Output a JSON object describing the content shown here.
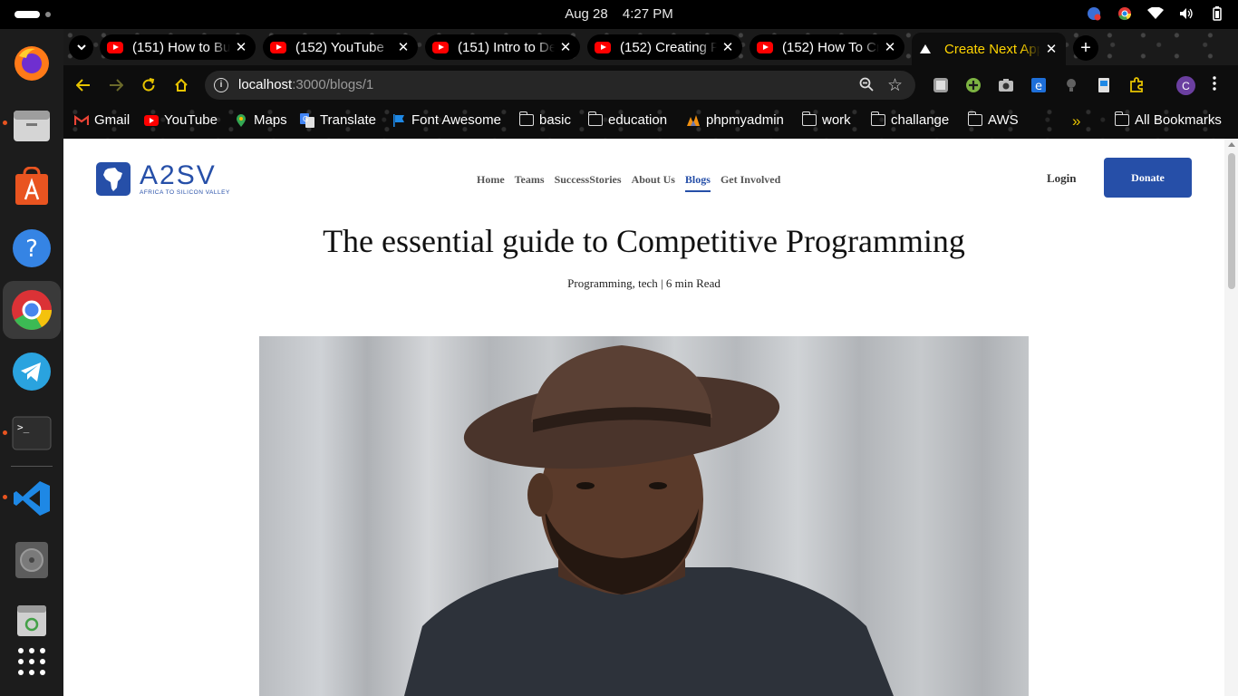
{
  "system": {
    "date": "Aug 28",
    "time": "4:27 PM"
  },
  "dock": {
    "items": [
      "Firefox",
      "Files",
      "App Center",
      "Help",
      "Google Chrome",
      "Telegram",
      "Terminal",
      "Visual Studio Code",
      "Disks",
      "Trash",
      "Show Apps"
    ]
  },
  "browser": {
    "tabs": [
      {
        "title": "(151) How to Bu",
        "icon": "youtube-icon"
      },
      {
        "title": "(152) YouTube",
        "icon": "youtube-icon"
      },
      {
        "title": "(151) Intro to De",
        "icon": "youtube-icon"
      },
      {
        "title": "(152) Creating P",
        "icon": "youtube-icon"
      },
      {
        "title": "(152) How To Cr",
        "icon": "youtube-icon"
      },
      {
        "title": "Create Next App",
        "icon": "nextjs-icon",
        "active": true
      }
    ],
    "url_host": "localhost",
    "url_path": ":3000/blogs/1",
    "profile_initial": "C",
    "bookmarks": [
      {
        "label": "Gmail",
        "icon": "gmail-icon"
      },
      {
        "label": "YouTube",
        "icon": "youtube-icon"
      },
      {
        "label": "Maps",
        "icon": "maps-icon"
      },
      {
        "label": "Translate",
        "icon": "translate-icon"
      },
      {
        "label": "Font Awesome",
        "icon": "flag-icon"
      },
      {
        "label": "basic",
        "icon": "folder-icon"
      },
      {
        "label": "education",
        "icon": "folder-icon"
      },
      {
        "label": "phpmyadmin",
        "icon": "phpmyadmin-icon"
      },
      {
        "label": "work",
        "icon": "folder-icon"
      },
      {
        "label": "challange",
        "icon": "folder-icon"
      },
      {
        "label": "AWS",
        "icon": "folder-icon"
      }
    ],
    "all_bookmarks": "All Bookmarks"
  },
  "site": {
    "logo_text": "A2SV",
    "logo_tagline": "AFRICA TO SILICON VALLEY",
    "nav": [
      "Home",
      "Teams",
      "SuccessStories",
      "About Us",
      "Blogs",
      "Get Involved"
    ],
    "nav_current": "Blogs",
    "login": "Login",
    "donate": "Donate"
  },
  "post": {
    "title": "The essential guide to Competitive Programming",
    "meta": "Programming, tech | 6 min Read"
  },
  "colors": {
    "brand": "#264fa8",
    "active_tab_text": "#ffd400"
  }
}
